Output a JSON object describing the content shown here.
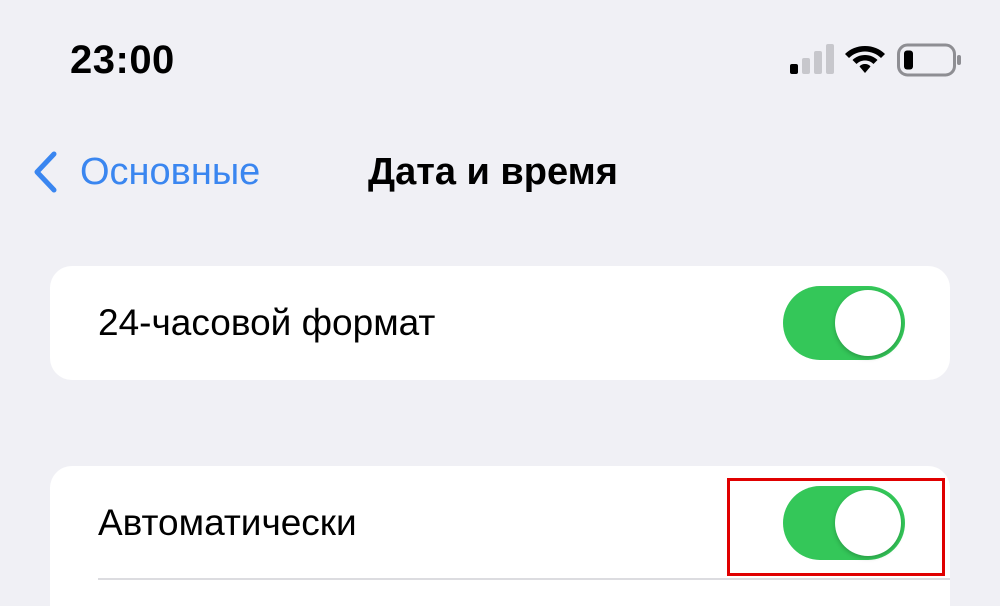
{
  "status_bar": {
    "time": "23:00",
    "signal_icon": "cellular-signal-icon",
    "wifi_icon": "wifi-icon",
    "battery_icon": "battery-icon"
  },
  "nav": {
    "back_label": "Основные",
    "back_icon": "chevron-left-icon",
    "title": "Дата и время"
  },
  "settings": [
    {
      "label": "24-часовой формат",
      "toggle_on": true
    },
    {
      "label": "Автоматически",
      "toggle_on": true,
      "highlighted": true
    }
  ],
  "colors": {
    "background": "#f0f0f5",
    "accent": "#3a86f0",
    "toggle_on": "#34c759",
    "highlight": "#e00000"
  }
}
